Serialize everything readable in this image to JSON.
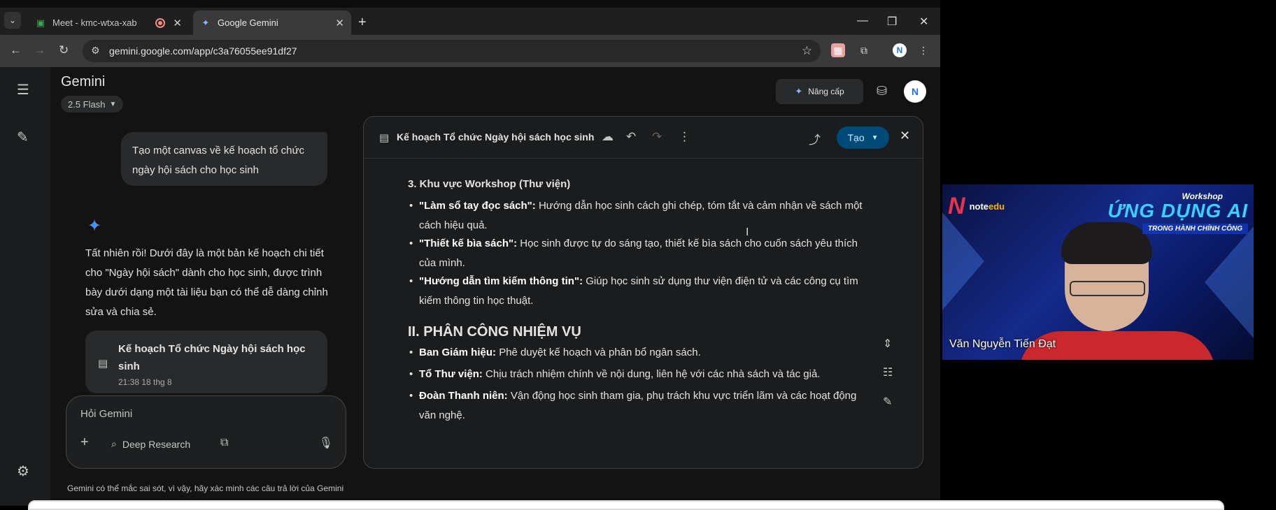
{
  "tabs": [
    {
      "label": "Meet - kmc-wtxa-xab",
      "icon": "google-meet-icon",
      "recording": true
    },
    {
      "label": "Google Gemini",
      "icon": "gemini-icon",
      "active": true
    }
  ],
  "url": "gemini.google.com/app/c3a76055ee91df27",
  "app": {
    "title": "Gemini",
    "model": "2.5 Flash",
    "upgrade_label": "Nâng cấp",
    "avatar_letter": "N"
  },
  "chat": {
    "user_message": "Tạo một canvas về kế hoạch tổ chức ngày hội sách cho học sinh",
    "response": "Tất nhiên rồi! Dưới đây là một bản kế hoạch chi tiết cho \"Ngày hội sách\" dành cho học sinh, được trình bày dưới dạng một tài liệu bạn có thể dễ dàng chỉnh sửa và chia sẻ.",
    "doc_card": {
      "title": "Kế hoạch Tổ chức Ngày hội sách học sinh",
      "date": "21:38 18 thg 8"
    },
    "input_placeholder": "Hỏi Gemini",
    "deep_research_label": "Deep Research",
    "disclaimer": "Gemini có thể mắc sai sót, vì vậy, hãy xác minh các câu trả lời của Gemini"
  },
  "canvas": {
    "title": "Kế hoạch Tổ chức Ngày hội sách học sinh",
    "create_label": "Tạo",
    "section3_heading": "3. Khu vực Workshop (Thư viện)",
    "section3_items": [
      {
        "bold": "\"Làm sổ tay đọc sách\":",
        "text": " Hướng dẫn học sinh cách ghi chép, tóm tắt và cảm nhận về sách một cách hiệu quả."
      },
      {
        "bold": "\"Thiết kế bìa sách\":",
        "text": " Học sinh được tự do sáng tạo, thiết kế bìa sách cho cuốn sách yêu thích của mình."
      },
      {
        "bold": "\"Hướng dẫn tìm kiếm thông tin\":",
        "text": " Giúp học sinh sử dụng thư viện điện tử và các công cụ tìm kiếm thông tin học thuật."
      }
    ],
    "section2_heading": "II. PHÂN CÔNG NHIỆM VỤ",
    "section2_items": [
      {
        "bold": "Ban Giám hiệu:",
        "text": " Phê duyệt kế hoạch và phân bổ ngân sách."
      },
      {
        "bold": "Tổ Thư viện:",
        "text": " Chịu trách nhiệm chính về nội dung, liên hệ với các nhà sách và tác giả."
      },
      {
        "bold": "Đoàn Thanh niên:",
        "text": " Vận động học sinh tham gia, phụ trách khu vực triển lãm và các hoạt động văn nghệ."
      }
    ]
  },
  "video": {
    "brand_letter": "N",
    "brand": "note",
    "brand_accent": "edu",
    "workshop_label": "Workshop",
    "workshop_title": "ỨNG DỤNG AI",
    "workshop_subtitle": "TRONG HÀNH CHÍNH CÔNG",
    "participant_name": "Văn Nguyễn Tiến Đạt"
  }
}
